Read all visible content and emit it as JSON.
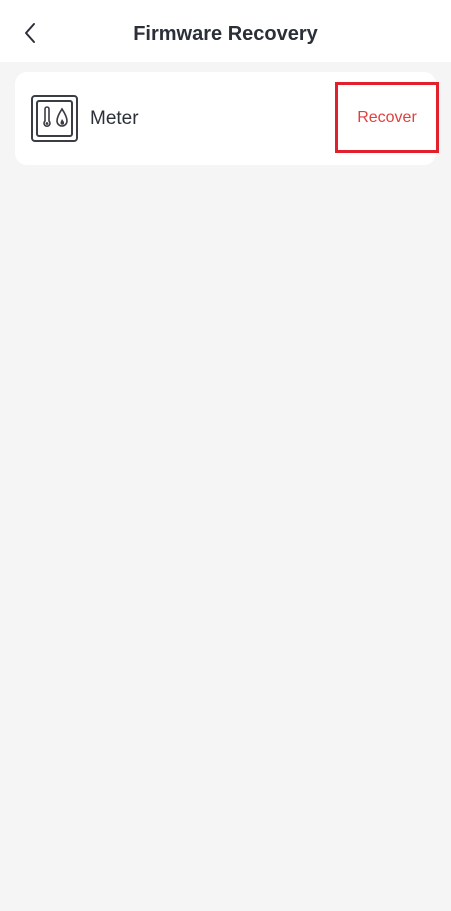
{
  "header": {
    "title": "Firmware Recovery",
    "back_icon": "chevron-left-icon"
  },
  "device": {
    "icon": "meter-thermometer-droplet-icon",
    "name": "Meter",
    "action_label": "Recover"
  },
  "colors": {
    "background": "#f5f5f5",
    "card": "#ffffff",
    "text": "#2b2f38",
    "action_text": "#e0403e",
    "highlight_border": "#e2202b"
  }
}
